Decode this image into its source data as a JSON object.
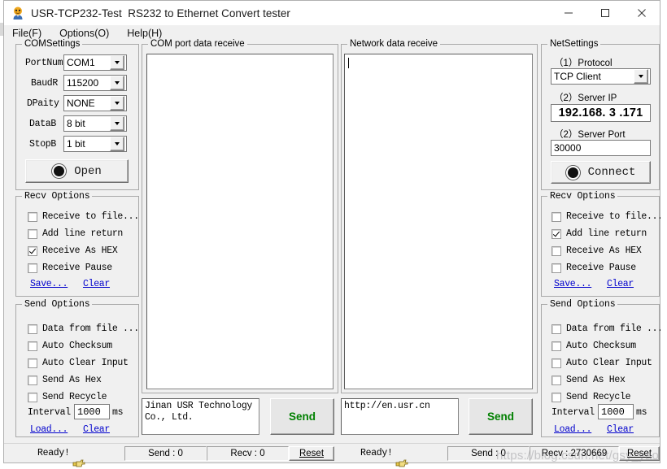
{
  "window": {
    "title": "USR-TCP232-Test  RS232 to Ethernet Convert tester",
    "icon": "app-icon",
    "minimize": "–",
    "maximize": "☐",
    "close": "✕"
  },
  "menubar": {
    "items": [
      {
        "label": "File(F)",
        "name": "menu-file"
      },
      {
        "label": "Options(O)",
        "name": "menu-options"
      },
      {
        "label": "Help(H)",
        "name": "menu-help"
      }
    ]
  },
  "com_settings": {
    "title": "COMSettings",
    "fields": [
      {
        "label": "PortNum",
        "value": "COM1"
      },
      {
        "label": "BaudR",
        "value": "115200"
      },
      {
        "label": "DPaity",
        "value": "NONE"
      },
      {
        "label": "DataB",
        "value": "8 bit"
      },
      {
        "label": "StopB",
        "value": "1 bit"
      }
    ],
    "open_button": "Open"
  },
  "com_recv_options": {
    "title": "Recv Options",
    "checkboxes": [
      {
        "label": "Receive to file...",
        "checked": false
      },
      {
        "label": "Add line return",
        "checked": false
      },
      {
        "label": "Receive As HEX",
        "checked": true
      },
      {
        "label": "Receive Pause",
        "checked": false
      }
    ],
    "save_link": "Save...",
    "clear_link": "Clear"
  },
  "com_send_options": {
    "title": "Send Options",
    "checkboxes": [
      {
        "label": "Data from file ...",
        "checked": false
      },
      {
        "label": "Auto Checksum",
        "checked": false
      },
      {
        "label": "Auto Clear Input",
        "checked": false
      },
      {
        "label": "Send As Hex",
        "checked": false
      },
      {
        "label": "Send Recycle",
        "checked": false
      }
    ],
    "interval_label": "Interval",
    "interval_value": "1000",
    "interval_unit": "ms",
    "load_link": "Load...",
    "clear_link": "Clear"
  },
  "com_receive_panel": {
    "title": "COM port data receive",
    "content": ""
  },
  "net_receive_panel": {
    "title": "Network data receive",
    "content": ""
  },
  "com_send": {
    "text": "Jinan USR Technology Co., Ltd.",
    "button": "Send"
  },
  "net_send": {
    "text": "http://en.usr.cn",
    "button": "Send"
  },
  "net_settings": {
    "title": "NetSettings",
    "protocol_label": "（1）Protocol",
    "protocol_value": "TCP Client",
    "server_ip_label": "（2）Server IP",
    "server_ip_value": "192.168. 3 .171",
    "server_port_label": "（2）Server Port",
    "server_port_value": "30000",
    "connect_button": "Connect"
  },
  "net_recv_options": {
    "title": "Recv Options",
    "checkboxes": [
      {
        "label": "Receive to file...",
        "checked": false
      },
      {
        "label": "Add line return",
        "checked": true
      },
      {
        "label": "Receive As HEX",
        "checked": false
      },
      {
        "label": "Receive Pause",
        "checked": false
      }
    ],
    "save_link": "Save...",
    "clear_link": "Clear"
  },
  "net_send_options": {
    "title": "Send Options",
    "checkboxes": [
      {
        "label": "Data from file ...",
        "checked": false
      },
      {
        "label": "Auto Checksum",
        "checked": false
      },
      {
        "label": "Auto Clear Input",
        "checked": false
      },
      {
        "label": "Send As Hex",
        "checked": false
      },
      {
        "label": "Send Recycle",
        "checked": false
      }
    ],
    "interval_label": "Interval",
    "interval_value": "1000",
    "interval_unit": "ms",
    "load_link": "Load...",
    "clear_link": "Clear"
  },
  "status_left": {
    "ready": "Ready!",
    "send": "Send : 0",
    "recv": "Recv : 0",
    "reset": "Reset"
  },
  "status_right": {
    "ready": "Ready!",
    "send": "Send : 0",
    "recv": "Recv : 2730669",
    "reset": "Reset"
  },
  "watermark": "https://blog.csdn.net/gsy_yao",
  "colors": {
    "send_button_text": "#008000",
    "link": "#0000cc",
    "window_bg": "#f0f0f0"
  }
}
